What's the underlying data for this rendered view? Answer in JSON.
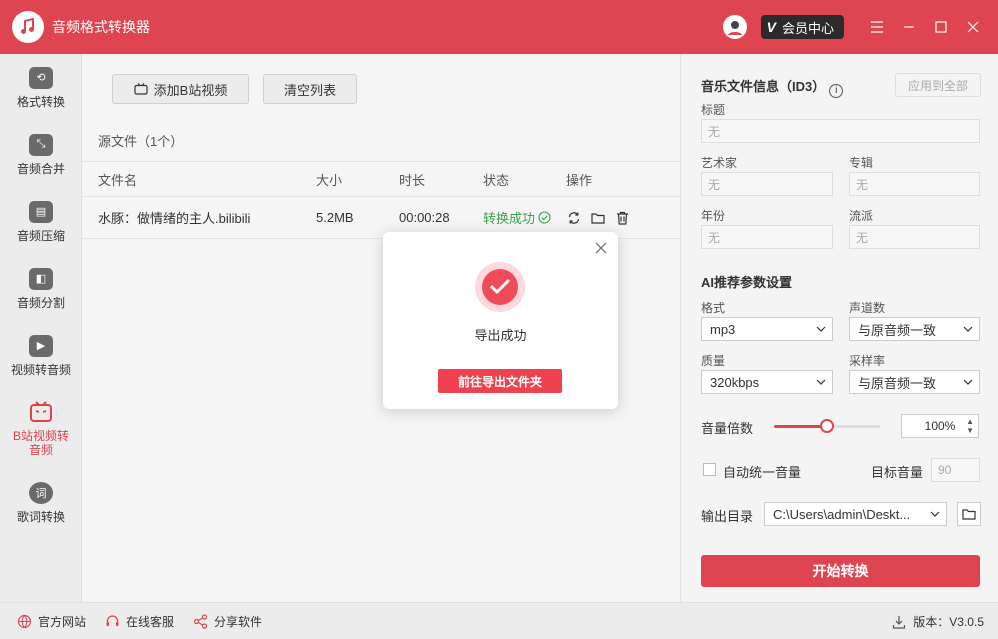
{
  "app": {
    "title": "音频格式转换器",
    "vip_label": "会员中心",
    "vip_badge": "V"
  },
  "sidebar": {
    "items": [
      {
        "label": "格式转换",
        "icon": "format-convert-icon"
      },
      {
        "label": "音频合并",
        "icon": "merge-icon"
      },
      {
        "label": "音频压缩",
        "icon": "compress-icon"
      },
      {
        "label": "音频分割",
        "icon": "split-icon"
      },
      {
        "label": "视频转音频",
        "icon": "video-to-audio-icon"
      },
      {
        "label": "B站视频转音频",
        "icon": "bilibili-icon",
        "active": true
      },
      {
        "label": "歌词转换",
        "icon": "lyrics-icon",
        "glyph": "词"
      }
    ]
  },
  "main": {
    "add_button": "添加B站视频",
    "clear_button": "清空列表",
    "source_title": "源文件（1个）",
    "columns": {
      "name": "文件名",
      "size": "大小",
      "duration": "时长",
      "status": "状态",
      "ops": "操作"
    },
    "rows": [
      {
        "name": "水豚：做情绪的主人.bilibili",
        "size": "5.2MB",
        "duration": "00:00:28",
        "status": "转换成功"
      }
    ]
  },
  "panel": {
    "id3_title": "音乐文件信息（ID3）",
    "info_glyph": "i",
    "apply_all": "应用到全部",
    "title_label": "标题",
    "title_placeholder": "无",
    "artist_label": "艺术家",
    "artist_placeholder": "无",
    "album_label": "专辑",
    "album_placeholder": "无",
    "year_label": "年份",
    "year_placeholder": "无",
    "genre_label": "流派",
    "genre_placeholder": "无",
    "ai_title": "AI推荐参数设置",
    "format_label": "格式",
    "format_value": "mp3",
    "channels_label": "声道数",
    "channels_value": "与原音频一致",
    "quality_label": "质量",
    "quality_value": "320kbps",
    "samplerate_label": "采样率",
    "samplerate_value": "与原音频一致",
    "volume_label": "音量倍数",
    "volume_value": "100%",
    "volume_level": 0.5,
    "auto_volume_label": "自动统一音量",
    "target_volume_label": "目标音量",
    "target_volume_value": "90",
    "output_label": "输出目录",
    "output_value": "C:\\Users\\admin\\Deskt...",
    "start_button": "开始转换"
  },
  "footer": {
    "website": "官方网站",
    "service": "在线客服",
    "share": "分享软件",
    "version": "版本：V3.0.5"
  },
  "modal": {
    "message": "导出成功",
    "button": "前往导出文件夹"
  },
  "colors": {
    "brand": "#df4550",
    "success": "#3aa24a"
  }
}
